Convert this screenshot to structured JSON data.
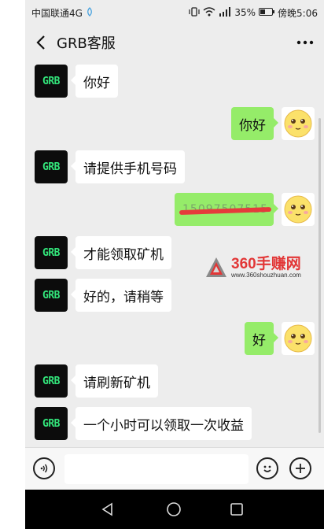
{
  "status": {
    "carrier": "中国联通4G",
    "battery": "35%",
    "time": "傍晚5:06"
  },
  "header": {
    "title": "GRB客服"
  },
  "messages": [
    {
      "side": "left",
      "text": "你好"
    },
    {
      "side": "right",
      "text": "你好"
    },
    {
      "side": "left",
      "text": "请提供手机号码"
    },
    {
      "side": "right",
      "text": "15097507515",
      "redacted": true
    },
    {
      "side": "left",
      "text": "才能领取矿机"
    },
    {
      "side": "left",
      "text": "好的，请稍等"
    },
    {
      "side": "right",
      "text": "好"
    },
    {
      "side": "left",
      "text": "请刷新矿机"
    },
    {
      "side": "left",
      "text": "一个小时可以领取一次收益"
    }
  ],
  "avatar_label": "GRB",
  "watermark": {
    "title": "360手赚网",
    "url": "www.360shouzhuan.com"
  },
  "colors": {
    "bubble_right": "#95ec69",
    "avatar_text": "#33e67b",
    "watermark_red": "#e23636"
  }
}
